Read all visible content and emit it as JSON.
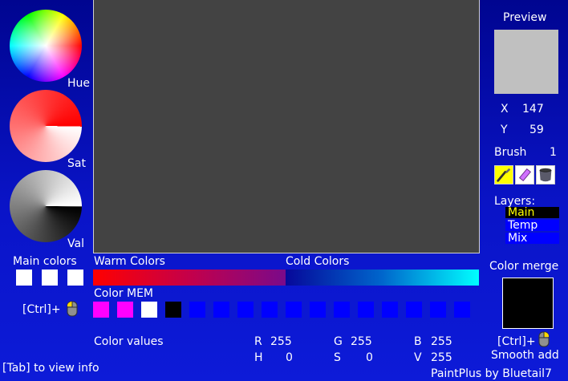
{
  "wheels": {
    "hue_label": "Hue",
    "sat_label": "Sat",
    "val_label": "Val"
  },
  "main_colors": {
    "label": "Main colors",
    "swatches": [
      "#ffffff",
      "#ffffff",
      "#ffffff"
    ]
  },
  "palette": {
    "warm_label": "Warm Colors",
    "cold_label": "Cold Colors"
  },
  "color_mem": {
    "label": "Color MEM",
    "shortcut": "[Ctrl]+",
    "swatches": [
      "#ff00ff",
      "#ff00ff",
      "#ffffff",
      "#000000",
      "#0000ff",
      "#0000ff",
      "#0000ff",
      "#0000ff",
      "#0000ff",
      "#0000ff",
      "#0000ff",
      "#0000ff",
      "#0000ff",
      "#0000ff",
      "#0000ff",
      "#0000ff"
    ]
  },
  "color_values": {
    "label": "Color values",
    "r_label": "R",
    "r": "255",
    "g_label": "G",
    "g": "255",
    "b_label": "B",
    "b": "255",
    "h_label": "H",
    "h": "0",
    "s_label": "S",
    "s": "0",
    "v_label": "V",
    "v": "255"
  },
  "preview": {
    "label": "Preview",
    "color": "#c0c0c0",
    "x_label": "X",
    "x": "147",
    "y_label": "Y",
    "y": "59"
  },
  "brush": {
    "label": "Brush",
    "size": "1",
    "tools": [
      "brush-icon",
      "eraser-icon",
      "bucket-icon"
    ]
  },
  "layers": {
    "label": "Layers:",
    "items": [
      "Main",
      "Temp",
      "Mix"
    ],
    "active": "Main"
  },
  "color_merge": {
    "label": "Color merge",
    "shortcut": "[Ctrl]+",
    "mode": "Smooth add"
  },
  "footer": {
    "hint": "[Tab] to view info",
    "credit": "PaintPlus by Bluetail7"
  }
}
